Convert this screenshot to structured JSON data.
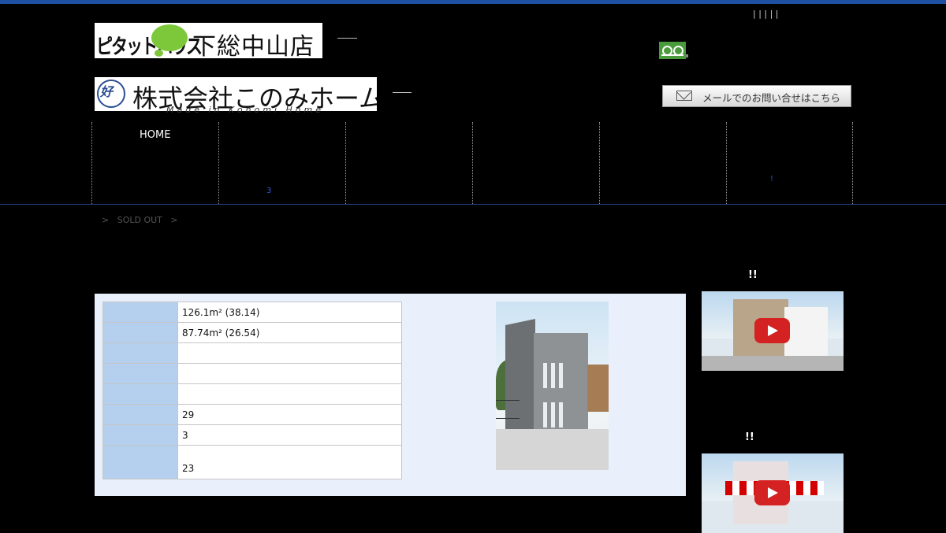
{
  "header": {
    "top_marks": "| | |          | |",
    "logo1": {
      "brand": "ピタットハウス",
      "store": "下総中山店"
    },
    "logo2": {
      "emblem": "好",
      "company": "株式会社このみホーム",
      "tagline": "Made in Konomi Home"
    },
    "mail_button_label": "メールでのお問い合せはこちら"
  },
  "nav": {
    "items": [
      {
        "label": "HOME"
      },
      {
        "label": "",
        "sub": "3"
      },
      {
        "label": ""
      },
      {
        "label": ""
      },
      {
        "label": ""
      },
      {
        "label": "",
        "sub": "!"
      }
    ]
  },
  "breadcrumb": {
    "sep1": ">",
    "current": "SOLD OUT",
    "sep2": ">"
  },
  "property": {
    "rows": [
      {
        "key": "",
        "value": "126.1m² (38.14)"
      },
      {
        "key": "",
        "value": "87.74m² (26.54)"
      },
      {
        "key": "",
        "value": ""
      },
      {
        "key": "",
        "value": ""
      },
      {
        "key": "",
        "value": ""
      },
      {
        "key": "",
        "value": "29"
      },
      {
        "key": "",
        "value": "3"
      },
      {
        "key": "",
        "value": "23"
      }
    ]
  },
  "sidebar": {
    "heading1": "!!",
    "heading2": "!!"
  },
  "colors": {
    "accent_blue": "#1f4fa0",
    "table_key_bg": "#b5d0ee",
    "panel_bg": "#e9f0fc",
    "freedial_green": "#4a9b3b"
  }
}
